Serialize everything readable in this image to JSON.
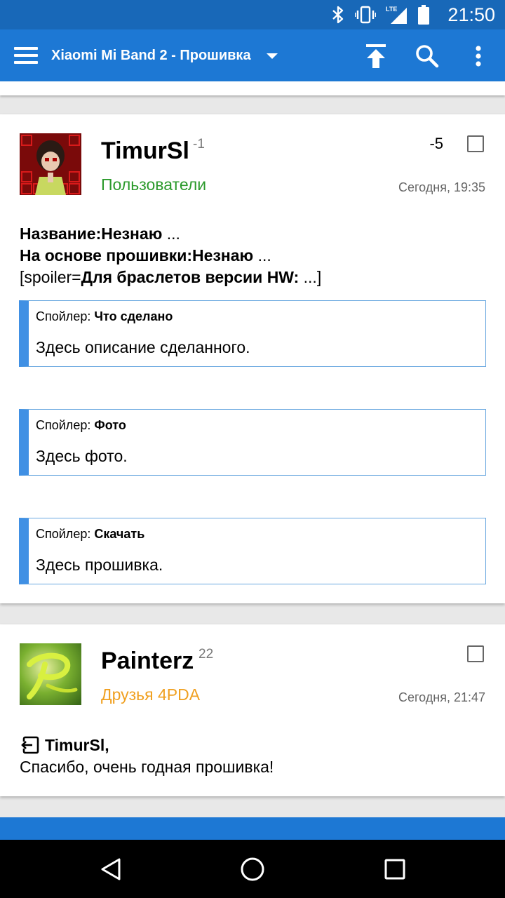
{
  "status_bar": {
    "time": "21:50",
    "network_label": "LTE",
    "icons": [
      "bluetooth-icon",
      "vibrate-icon",
      "lte-signal-icon",
      "battery-icon"
    ]
  },
  "app_bar": {
    "title": "Xiaomi Mi Band 2 - Прошивка",
    "icons": [
      "menu-icon",
      "dropdown-caret-icon",
      "scroll-top-icon",
      "search-icon",
      "more-vert-icon"
    ],
    "background": "#1d78d4"
  },
  "posts": [
    {
      "author": "TimurSl",
      "reputation": "-1",
      "group": "Пользователи",
      "group_color": "#2b9a2b",
      "date": "Сегодня, 19:35",
      "rating": "-5",
      "lines": [
        {
          "bold": "Название:Незнаю",
          "text": " ..."
        },
        {
          "bold": "На основе прошивки:Незнаю",
          "text": " ..."
        },
        {
          "prefix": "[spoiler=",
          "bold": "Для браслетов версии HW:",
          "text": " ...]"
        }
      ],
      "spoilers": [
        {
          "label": "Спойлер:",
          "title": "Что сделано",
          "content": "Здесь описание сделанного."
        },
        {
          "label": "Спойлер:",
          "title": "Фото",
          "content": "Здесь фото."
        },
        {
          "label": "Спойлер:",
          "title": "Скачать",
          "content": "Здесь прошивка."
        }
      ]
    },
    {
      "author": "Painterz",
      "reputation": "22",
      "group": "Друзья 4PDA",
      "group_color": "#f0a020",
      "date": "Сегодня, 21:47",
      "quote_name": "TimurSl,",
      "text": "Спасибо, очень годная прошивка!"
    }
  ],
  "bottom_bar": {
    "partial_text": ""
  },
  "nav_bar": {
    "icons": [
      "back-icon",
      "home-icon",
      "recents-icon"
    ]
  }
}
